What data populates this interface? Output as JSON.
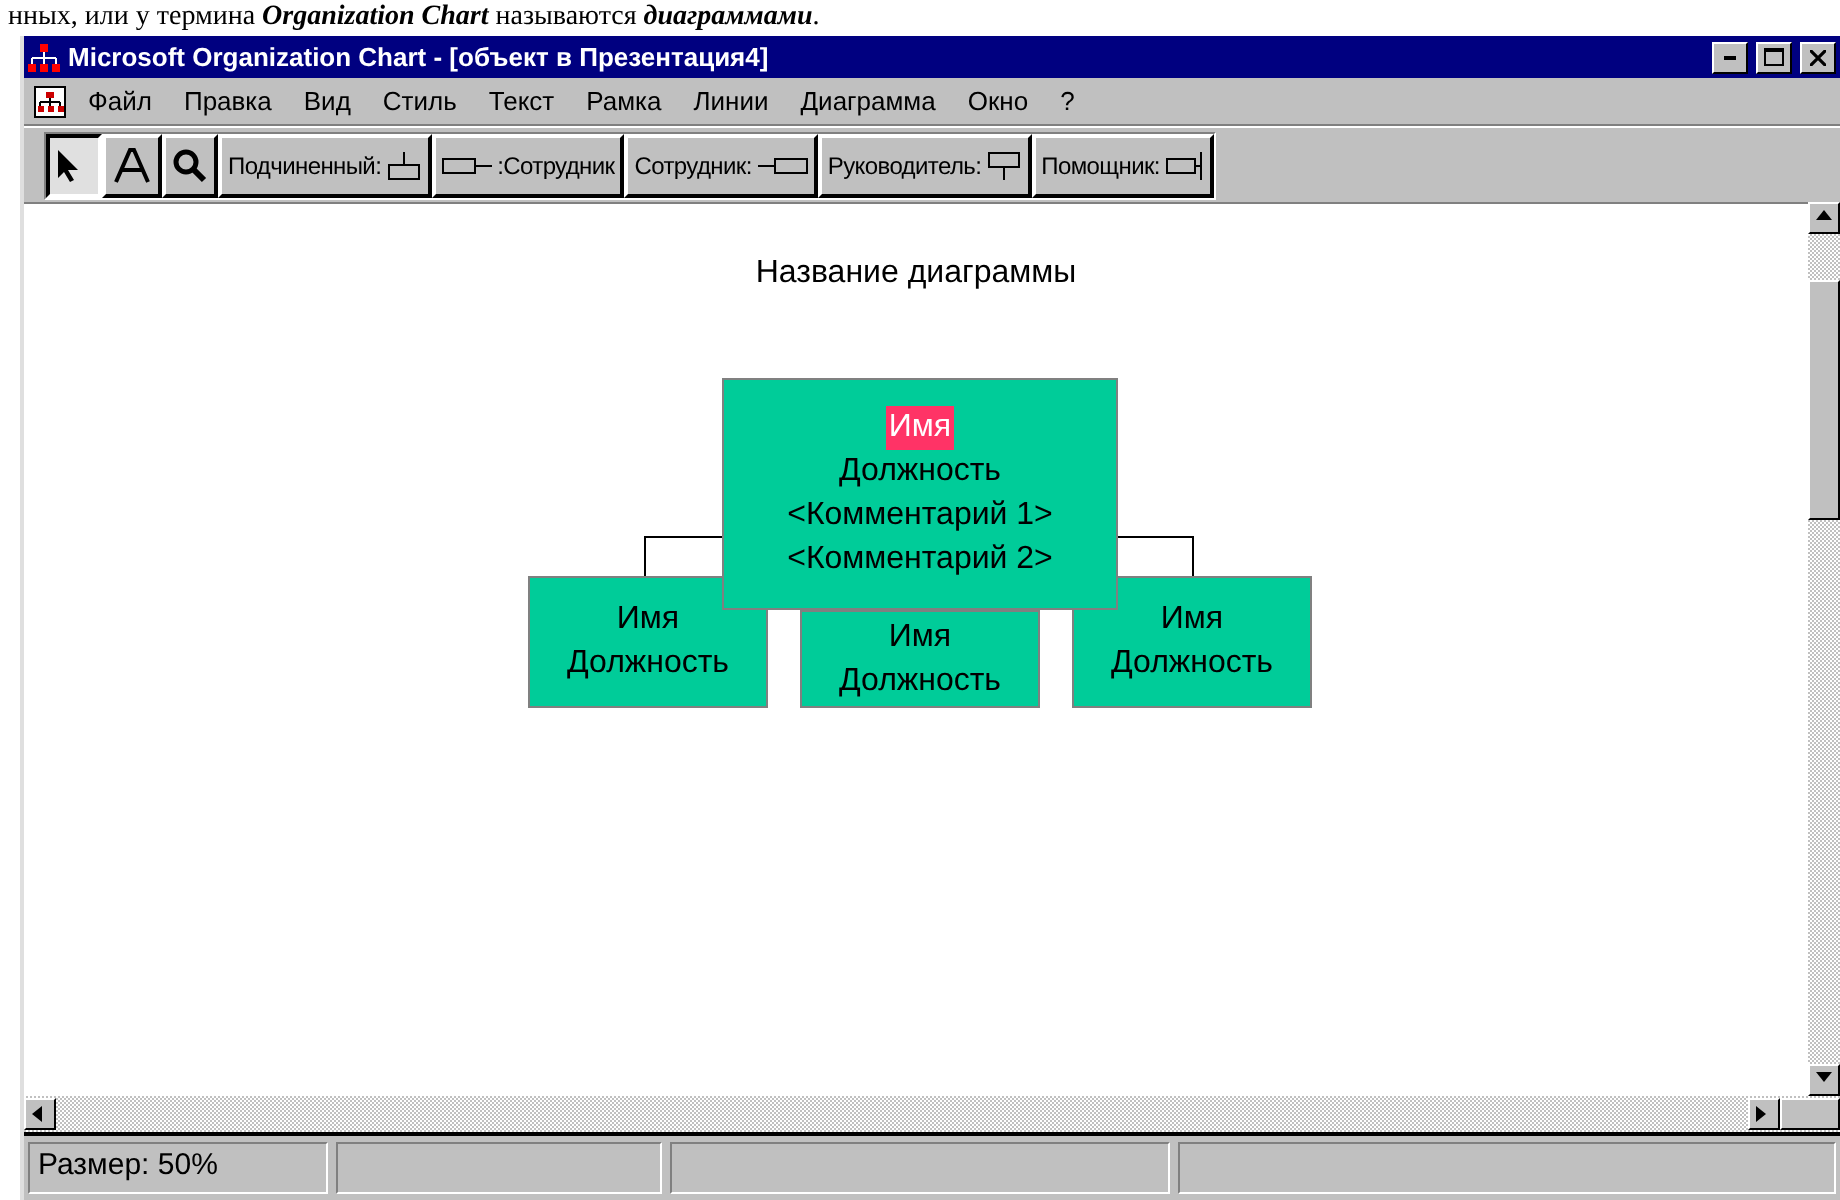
{
  "document_text": "нных, или у термина **Organization Chart** называются **диаграммами**.",
  "window": {
    "title": "Microsoft Organization Chart - [объект в Презентация4]"
  },
  "menu": [
    {
      "label": "Файл"
    },
    {
      "label": "Правка"
    },
    {
      "label": "Вид"
    },
    {
      "label": "Стиль"
    },
    {
      "label": "Текст"
    },
    {
      "label": "Рамка"
    },
    {
      "label": "Линии"
    },
    {
      "label": "Диаграмма"
    },
    {
      "label": "Окно"
    },
    {
      "label": "?"
    }
  ],
  "tools": [
    {
      "kind": "pointer",
      "selected": true
    },
    {
      "kind": "text",
      "selected": false
    },
    {
      "kind": "zoom",
      "selected": false
    }
  ],
  "box_tools": [
    {
      "label": "Подчиненный:",
      "kind": "subordinate",
      "icon_first": false
    },
    {
      "label": ":Сотрудник",
      "kind": "coworker-left",
      "icon_first": true
    },
    {
      "label": "Сотрудник:",
      "kind": "coworker-right",
      "icon_first": false
    },
    {
      "label": "Руководитель:",
      "kind": "manager",
      "icon_first": false
    },
    {
      "label": "Помощник:",
      "kind": "assistant",
      "icon_first": false
    }
  ],
  "chart": {
    "title": "Название диаграммы",
    "manager": {
      "lines": [
        {
          "text": "Имя",
          "highlighted": true
        },
        {
          "text": "Должность",
          "highlighted": false
        },
        {
          "text": "<Комментарий 1>",
          "highlighted": false
        },
        {
          "text": "<Комментарий 2>",
          "highlighted": false
        }
      ]
    },
    "subordinates": [
      {
        "lines": [
          "Имя",
          "Должность"
        ]
      },
      {
        "lines": [
          "Имя",
          "Должность"
        ]
      },
      {
        "lines": [
          "Имя",
          "Должность"
        ]
      }
    ]
  },
  "status_bar": {
    "panes": [
      "Размер: 50%"
    ]
  }
}
